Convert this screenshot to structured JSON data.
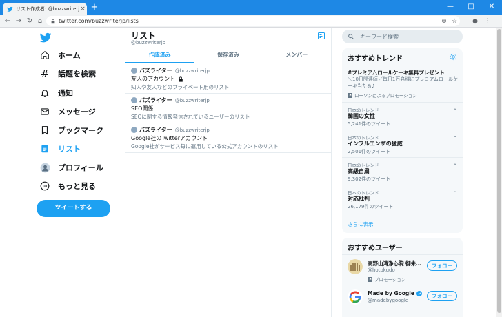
{
  "browser": {
    "tab_title": "リスト作成者: @buzzwriterjp / Twi",
    "tab_close": "×",
    "new_tab": "+",
    "url": "twitter.com/buzzwriterjp/lists",
    "win_minimize": "—",
    "win_maximize": "□",
    "win_close": "✕",
    "back": "←",
    "forward": "→",
    "reload": "↻",
    "home": "⌂",
    "star": "☆",
    "menu": "⋮"
  },
  "nav": {
    "items": [
      {
        "label": "ホーム",
        "icon": "home-icon"
      },
      {
        "label": "話題を検索",
        "icon": "hashtag-icon"
      },
      {
        "label": "通知",
        "icon": "bell-icon"
      },
      {
        "label": "メッセージ",
        "icon": "mail-icon"
      },
      {
        "label": "ブックマーク",
        "icon": "bookmark-icon"
      },
      {
        "label": "リスト",
        "icon": "list-icon"
      },
      {
        "label": "プロフィール",
        "icon": "avatar-icon"
      },
      {
        "label": "もっと見る",
        "icon": "more-icon"
      }
    ],
    "tweet_button": "ツイートする"
  },
  "main": {
    "title": "リスト",
    "subtitle": "@buzzwriterjp",
    "tabs": [
      "作成済み",
      "保存済み",
      "メンバー"
    ],
    "lists": [
      {
        "user": "バズライター",
        "handle": "@buzzwriterjp",
        "name": "友人のアカウント",
        "private": true,
        "desc": "知人や友人などのプライベート用のリスト"
      },
      {
        "user": "バズライター",
        "handle": "@buzzwriterjp",
        "name": "SEO関係",
        "private": false,
        "desc": "SEOに関する情報発信されているユーザーのリスト"
      },
      {
        "user": "バズライター",
        "handle": "@buzzwriterjp",
        "name": "Google社のTwitterアカウント",
        "private": false,
        "desc": "Google社がサービス毎に運用している公式アカウントのリスト"
      }
    ]
  },
  "right": {
    "search_placeholder": "キーワード検索",
    "trends_title": "おすすめトレンド",
    "promo": {
      "title": "#プレミアムロールケーキ無料プレゼント",
      "desc": "＼10日間連続／毎日1万名様にプレミアムロールケーキ当たる♪",
      "by": "ローソンによるプロモーション"
    },
    "trends": [
      {
        "category": "日本のトレンド",
        "name": "韓国の女性",
        "count": "5,241件のツイート"
      },
      {
        "category": "日本のトレンド",
        "name": "インフルエンザの猛威",
        "count": "2,501件のツイート"
      },
      {
        "category": "日本のトレンド",
        "name": "高級自粛",
        "count": "9,302件のツイート"
      },
      {
        "category": "日本のトレンド",
        "name": "対応批判",
        "count": "26,179件のツイート"
      }
    ],
    "show_more": "さらに表示",
    "users_title": "おすすめユーザー",
    "users": [
      {
        "name": "高野山清浄心院 御朱…",
        "handle": "@hotokudo",
        "promoted": "プロモーション",
        "follow": "フォロー"
      },
      {
        "name": "Made by Google",
        "handle": "@madebygoogle",
        "follow": "フォロー"
      }
    ]
  }
}
